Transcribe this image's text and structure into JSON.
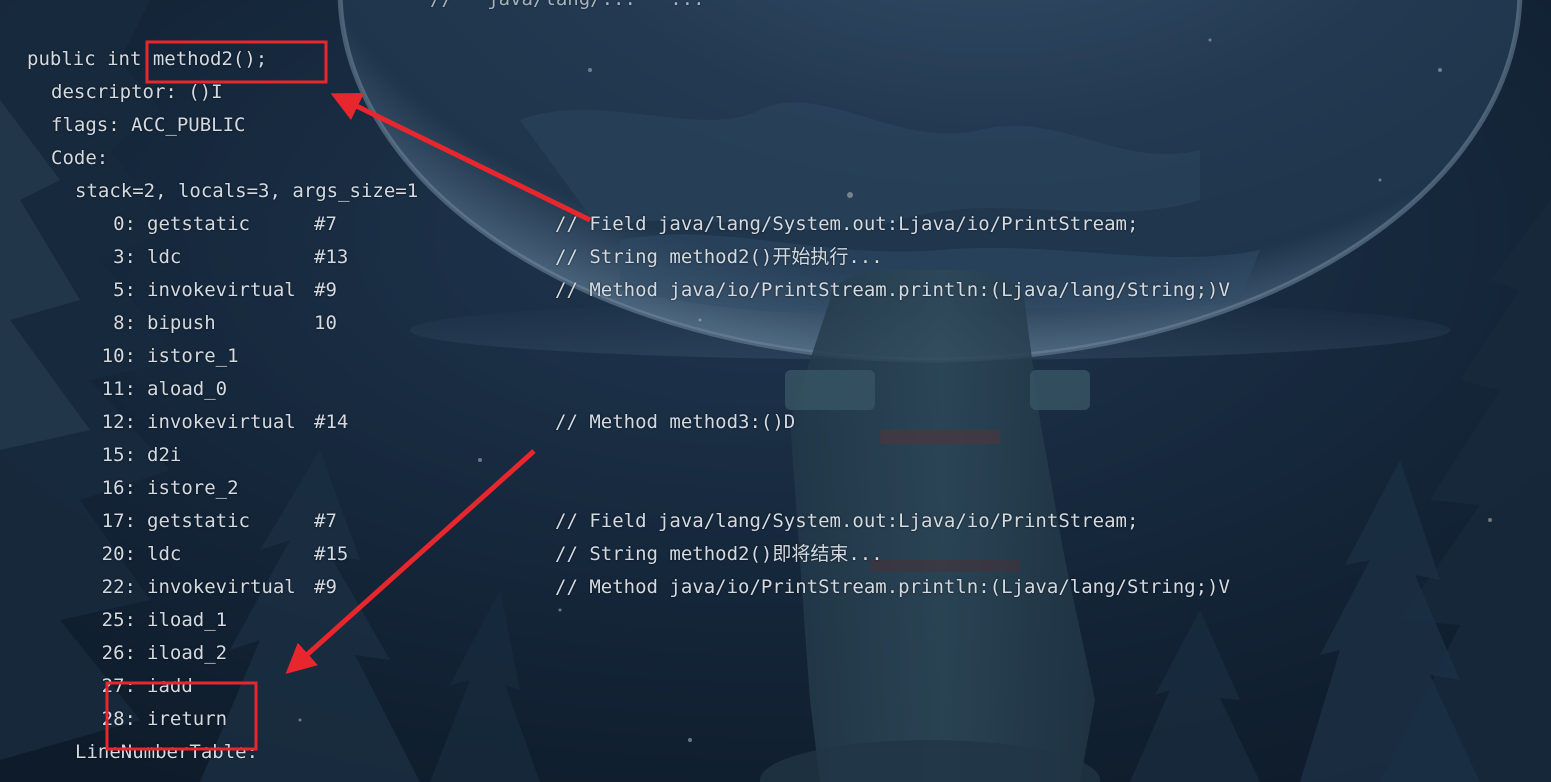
{
  "code": {
    "top_fragment": "//   java/lang/...   ...",
    "header": "public int method2();",
    "descriptor": "descriptor: ()I",
    "flags": "flags: ACC_PUBLIC",
    "code_label": "Code:",
    "stack_info": "stack=2, locals=3, args_size=1",
    "instructions": [
      {
        "offset": "0:",
        "op": "getstatic",
        "arg": "#7",
        "comment": "// Field java/lang/System.out:Ljava/io/PrintStream;"
      },
      {
        "offset": "3:",
        "op": "ldc",
        "arg": "#13",
        "comment": "// String method2()开始执行..."
      },
      {
        "offset": "5:",
        "op": "invokevirtual",
        "arg": "#9",
        "comment": "// Method java/io/PrintStream.println:(Ljava/lang/String;)V"
      },
      {
        "offset": "8:",
        "op": "bipush",
        "arg": "10",
        "comment": ""
      },
      {
        "offset": "10:",
        "op": "istore_1",
        "arg": "",
        "comment": ""
      },
      {
        "offset": "11:",
        "op": "aload_0",
        "arg": "",
        "comment": ""
      },
      {
        "offset": "12:",
        "op": "invokevirtual",
        "arg": "#14",
        "comment": "// Method method3:()D"
      },
      {
        "offset": "15:",
        "op": "d2i",
        "arg": "",
        "comment": ""
      },
      {
        "offset": "16:",
        "op": "istore_2",
        "arg": "",
        "comment": ""
      },
      {
        "offset": "17:",
        "op": "getstatic",
        "arg": "#7",
        "comment": "// Field java/lang/System.out:Ljava/io/PrintStream;"
      },
      {
        "offset": "20:",
        "op": "ldc",
        "arg": "#15",
        "comment": "// String method2()即将结束..."
      },
      {
        "offset": "22:",
        "op": "invokevirtual",
        "arg": "#9",
        "comment": "// Method java/io/PrintStream.println:(Ljava/lang/String;)V"
      },
      {
        "offset": "25:",
        "op": "iload_1",
        "arg": "",
        "comment": ""
      },
      {
        "offset": "26:",
        "op": "iload_2",
        "arg": "",
        "comment": ""
      },
      {
        "offset": "27:",
        "op": "iadd",
        "arg": "",
        "comment": ""
      },
      {
        "offset": "28:",
        "op": "ireturn",
        "arg": "",
        "comment": ""
      }
    ],
    "footer": "LineNumberTable:"
  },
  "annotations": {
    "color": "#e8262d"
  },
  "colors": {
    "text": "#d3d9e0",
    "background": "#16283a"
  }
}
